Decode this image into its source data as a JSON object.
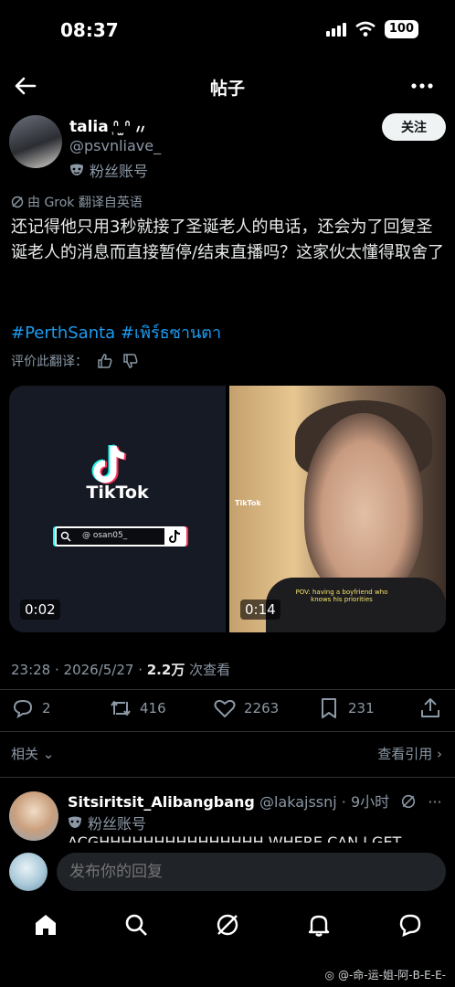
{
  "status": {
    "time": "08:37",
    "battery": "100"
  },
  "topbar": {
    "title": "帖子"
  },
  "author": {
    "name": "talia ᷂ᐢ ̫ᐢ ៸៸",
    "handle": "@psvnliave_",
    "badge": "粉丝账号",
    "follow_label": "关注"
  },
  "post": {
    "translated_note": "由 Grok 翻译自英语",
    "text": "还记得他只用3秒就接了圣诞老人的电话，还会为了回复圣诞老人的消息而直接暂停/结束直播吗？这家伙太懂得取舍了",
    "hashtags": "#PerthSanta #เพิร์ธซานตา",
    "rate_label": "评价此翻译：",
    "media": [
      {
        "duration": "0:02",
        "brand": "TikTok",
        "search_text": "@ osan05_"
      },
      {
        "duration": "0:14",
        "brand_tag": "TikTok",
        "pov_text": "POV: having a boyfriend who knows his priorities"
      }
    ],
    "time": "23:28 · 2026/5/27 · ",
    "views": "2.2万",
    "views_label": " 次查看"
  },
  "actions": {
    "replies": "2",
    "reposts": "416",
    "likes": "2263",
    "bookmarks": "231"
  },
  "related_label": "相关",
  "quotes_label": "查看引用",
  "reply": {
    "name": "Sitsiritsit_Alibangbang",
    "meta": " @lakajssnj · 9小时",
    "badge": "粉丝账号",
    "text": "ACGHHHHHHHHHHHHHHH WHERE CAN I GET"
  },
  "compose": {
    "placeholder": "发布你的回复"
  },
  "watermark": "@-命-运-姐-阿-B-E-E-"
}
